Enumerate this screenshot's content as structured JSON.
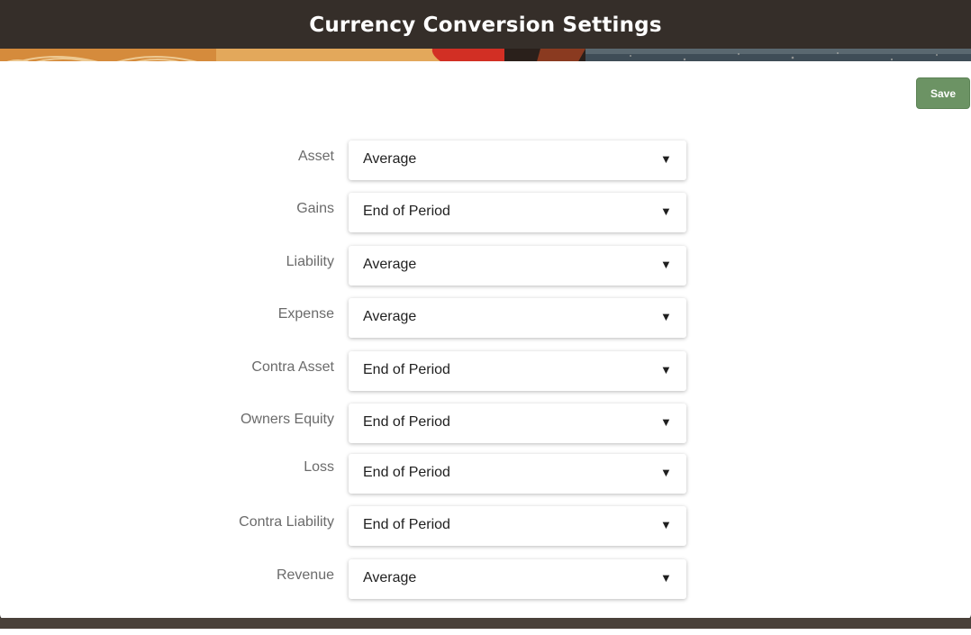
{
  "header": {
    "title": "Currency Conversion Settings"
  },
  "toolbar": {
    "save_label": "Save"
  },
  "icons": {
    "dropdown_caret": "caret-down-icon"
  },
  "colors": {
    "header_bg": "#352e29",
    "save_button": "#6c9364",
    "label_text": "#6b6b6b"
  },
  "settings": [
    {
      "label": "Asset",
      "value": "Average"
    },
    {
      "label": "Gains",
      "value": "End of Period"
    },
    {
      "label": "Liability",
      "value": "Average"
    },
    {
      "label": "Expense",
      "value": "Average"
    },
    {
      "label": "Contra Asset",
      "value": "End of Period"
    },
    {
      "label": "Owners Equity",
      "value": "End of Period"
    },
    {
      "label": "Loss",
      "value": "End of Period"
    },
    {
      "label": "Contra Liability",
      "value": "End of Period"
    },
    {
      "label": "Revenue",
      "value": "Average"
    }
  ]
}
